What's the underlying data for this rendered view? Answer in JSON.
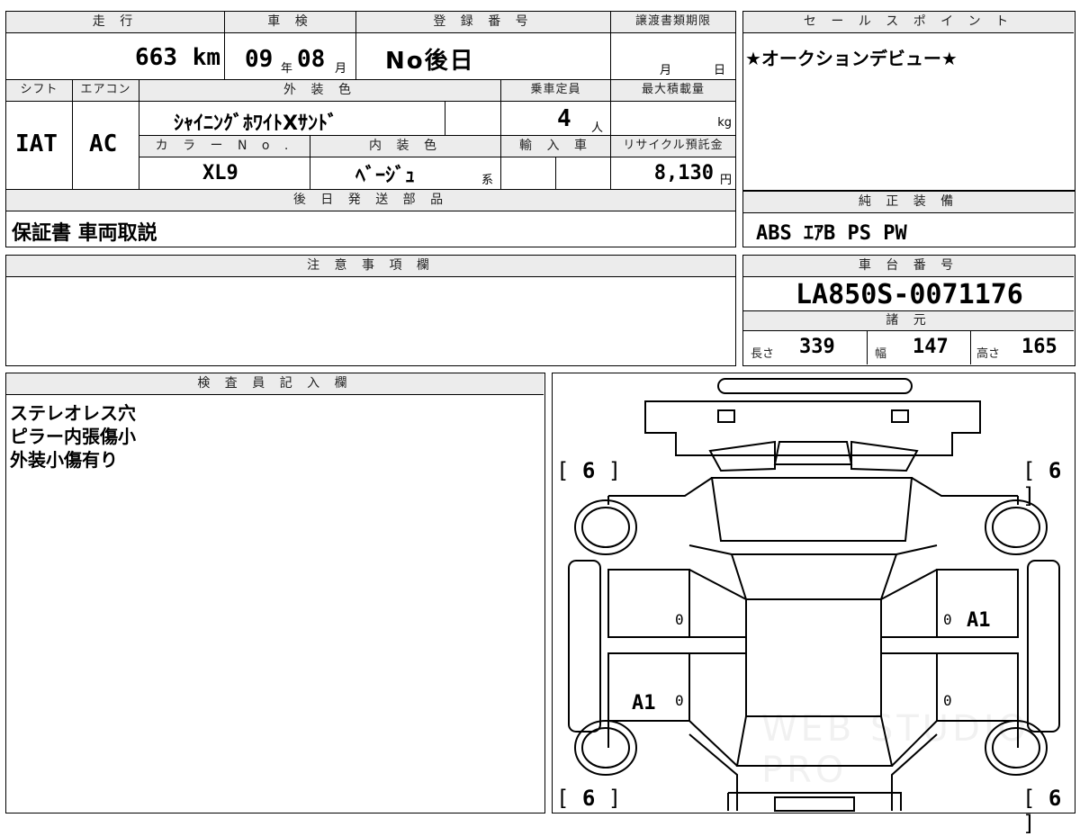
{
  "top": {
    "mileage_header": "走 行",
    "mileage_value": "663",
    "mileage_unit": "km",
    "shaken_header": "車 検",
    "shaken_year": "09",
    "shaken_year_unit": "年",
    "shaken_month": "08",
    "shaken_month_unit": "月",
    "reg_header": "登 録 番 号",
    "reg_value": "No後日",
    "doc_deadline_header": "譲渡書類期限",
    "doc_month_unit": "月",
    "doc_day_unit": "日"
  },
  "row2": {
    "shift_header": "シフト",
    "ac_header": "エアコン",
    "exterior_color_header": "外 装 色",
    "capacity_header": "乗車定員",
    "max_load_header": "最大積載量",
    "shift_value": "IAT",
    "ac_value": "AC",
    "exterior_color_value": "ｼｬｲﾆﾝｸﾞﾎﾜｲﾄXｻﾝﾄﾞ",
    "capacity_value": "4",
    "capacity_unit": "人",
    "max_load_unit": "kg",
    "color_no_header": "カ ラ ー N o .",
    "interior_color_header": "内 装 色",
    "import_header": "輸 入 車",
    "recycle_header": "リサイクル預託金",
    "color_no_value": "XL9",
    "interior_color_value": "ﾍﾞｰｼﾞｭ",
    "interior_color_suffix": "系",
    "recycle_value": "8,130",
    "recycle_unit": "円"
  },
  "later_parts": {
    "header": "後 日 発 送 部 品",
    "value": "保証書 車両取説"
  },
  "notes": {
    "header": "注 意 事 項 欄"
  },
  "sales_point": {
    "header": "セ ー ル ス ポ イ ン ト",
    "value": "★オークションデビュー★"
  },
  "equipment": {
    "header": "純 正 装 備",
    "value": "ABS ｴｱB PS PW"
  },
  "chassis": {
    "header": "車 台 番 号",
    "value": "LA850S-0071176",
    "specs_header": "諸 元",
    "length_label": "長さ",
    "length_value": "339",
    "width_label": "幅",
    "width_value": "147",
    "height_label": "高さ",
    "height_value": "165"
  },
  "inspector": {
    "header": "検 査 員 記 入 欄",
    "lines": [
      "ステレオレス穴",
      "ピラー内張傷小",
      "外装小傷有り"
    ]
  },
  "diagram": {
    "tire_fl": "6",
    "tire_fr": "6",
    "tire_rl": "6",
    "tire_rr": "6",
    "left_front_door_num": "0",
    "left_rear_door_num": "0",
    "right_front_door_num": "0",
    "right_rear_door_num": "0",
    "right_front_door_code": "A1",
    "left_rear_door_code": "A1",
    "watermark": "WEB STUDIO PRO"
  }
}
